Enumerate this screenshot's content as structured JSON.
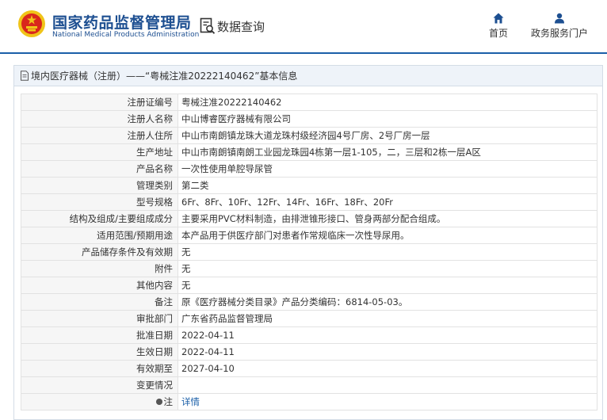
{
  "header": {
    "title_cn": "国家药品监督管理局",
    "title_en": "National Medical Products Administration",
    "query_label": "数据查询",
    "nav_home": "首页",
    "nav_services": "政务服务门户"
  },
  "panel": {
    "title": "境内医疗器械（注册）——“粤械注准20222140462”基本信息"
  },
  "rows": [
    {
      "label": "注册证编号",
      "value": "粤械注准20222140462"
    },
    {
      "label": "注册人名称",
      "value": "中山博睿医疗器械有限公司"
    },
    {
      "label": "注册人住所",
      "value": "中山市南朗镇龙珠大道龙珠村级经济园4号厂房、2号厂房一层"
    },
    {
      "label": "生产地址",
      "value": "中山市南朗镇南朗工业园龙珠园4栋第一层1-105，二，三层和2栋一层A区"
    },
    {
      "label": "产品名称",
      "value": "一次性使用单腔导尿管"
    },
    {
      "label": "管理类别",
      "value": "第二类"
    },
    {
      "label": "型号规格",
      "value": "6Fr、8Fr、10Fr、12Fr、14Fr、16Fr、18Fr、20Fr"
    },
    {
      "label": "结构及组成/主要组成成分",
      "value": "主要采用PVC材料制造，由排泄锥形接口、管身两部分配合组成。"
    },
    {
      "label": "适用范围/预期用途",
      "value": "本产品用于供医疗部门对患者作常规临床一次性导尿用。"
    },
    {
      "label": "产品储存条件及有效期",
      "value": "无"
    },
    {
      "label": "附件",
      "value": "无"
    },
    {
      "label": "其他内容",
      "value": "无"
    },
    {
      "label": "备注",
      "value": "原《医疗器械分类目录》产品分类编码：6814-05-03。"
    },
    {
      "label": "审批部门",
      "value": "广东省药品监督管理局"
    },
    {
      "label": "批准日期",
      "value": "2022-04-11"
    },
    {
      "label": "生效日期",
      "value": "2022-04-11"
    },
    {
      "label": "有效期至",
      "value": "2027-04-10"
    },
    {
      "label": "变更情况",
      "value": ""
    }
  ],
  "note_row": {
    "label": "注",
    "link": "详情"
  },
  "icons": {
    "emblem": "national-emblem-icon",
    "query": "data-query-icon",
    "home": "home-icon",
    "services": "user-icon",
    "title": "document-icon"
  },
  "colors": {
    "brand": "#1d4f91",
    "accent": "#1a5fa8",
    "title_bg": "#eef3f9",
    "label_bg": "#f6f6f6"
  }
}
